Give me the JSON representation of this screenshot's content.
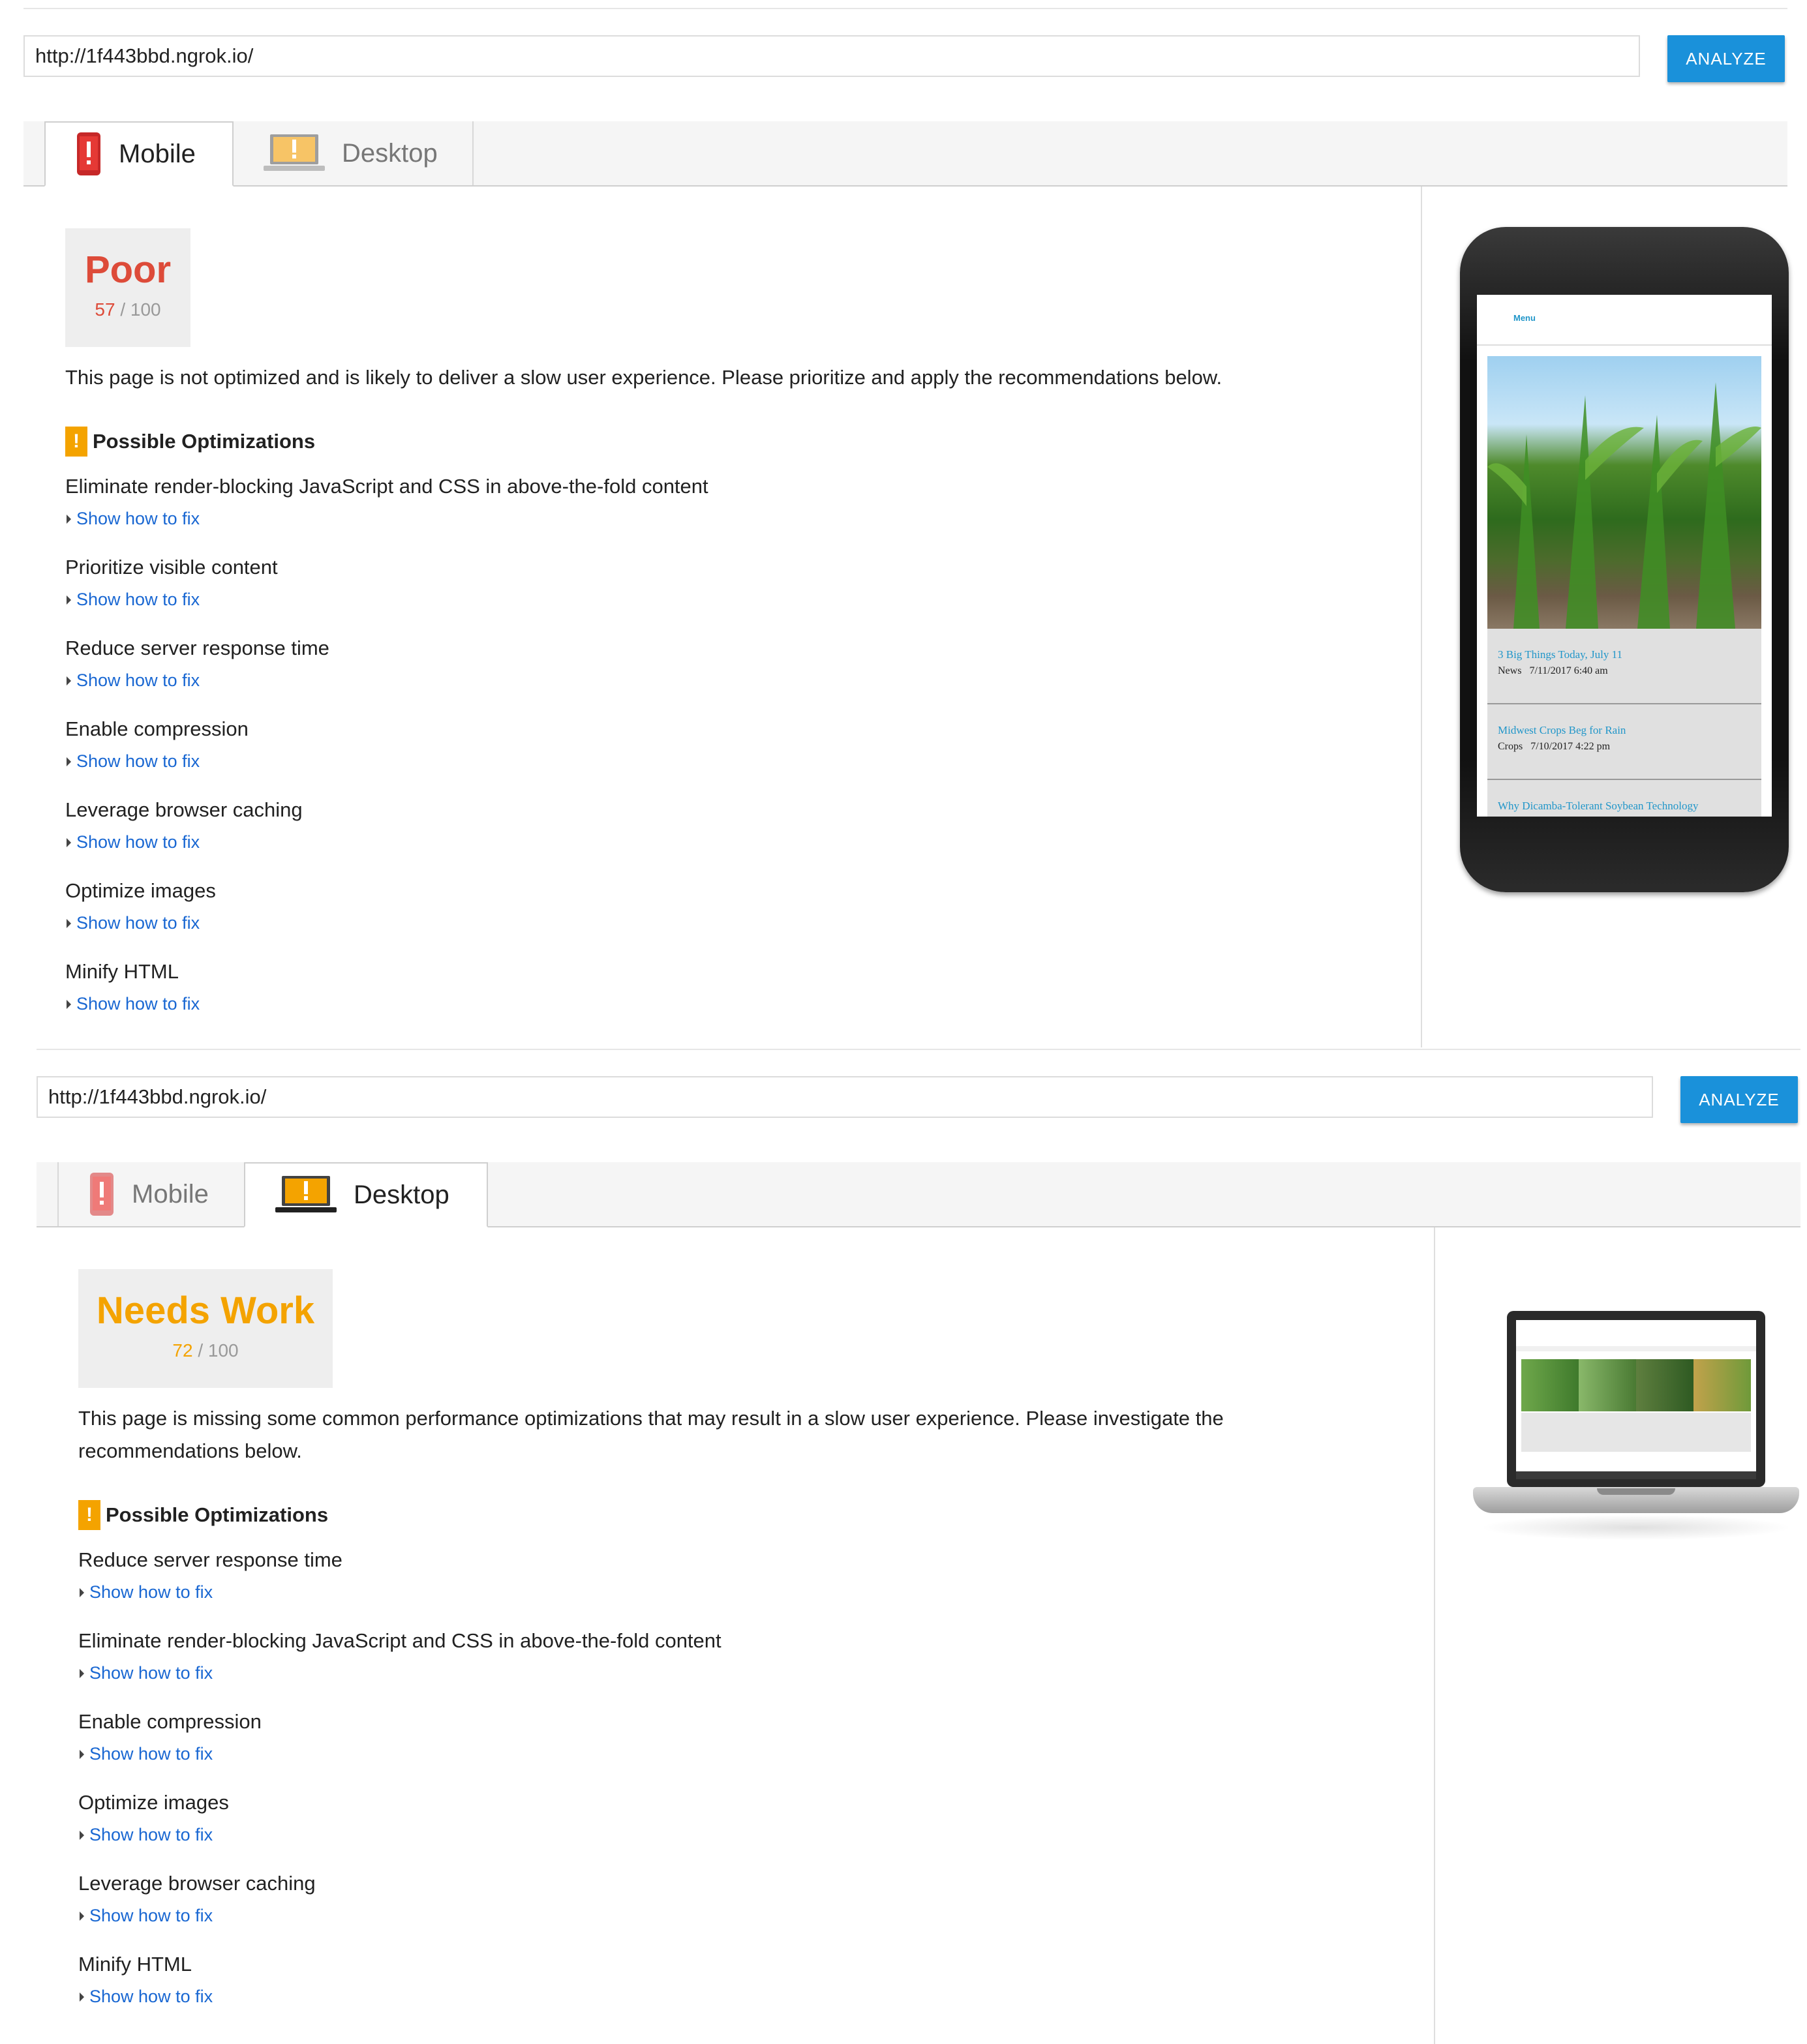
{
  "colors": {
    "accent": "#1a91da",
    "poor": "#dd4b39",
    "needs_work": "#f4a300",
    "link": "#1967d2"
  },
  "top": {
    "url_value": "http://1f443bbd.ngrok.io/",
    "analyze_label": "ANALYZE",
    "tabs": [
      {
        "label": "Mobile",
        "icon": "mobile-warning-icon",
        "active": true
      },
      {
        "label": "Desktop",
        "icon": "desktop-warning-icon",
        "active": false
      }
    ],
    "score": {
      "label": "Poor",
      "value": "57",
      "max": "/ 100"
    },
    "summary": "This page is not optimized and is likely to deliver a slow user experience. Please prioritize and apply the recommendations below.",
    "opt_heading": "Possible Optimizations",
    "rules": [
      "Eliminate render-blocking JavaScript and CSS in above-the-fold content",
      "Prioritize visible content",
      "Reduce server response time",
      "Enable compression",
      "Leverage browser caching",
      "Optimize images",
      "Minify HTML"
    ],
    "fix_label": "Show how to fix",
    "preview": {
      "menu": "Menu",
      "posts": [
        {
          "title": "3 Big Things Today, July 11",
          "category": "News",
          "date": "7/11/2017 6:40 am"
        },
        {
          "title": "Midwest Crops Beg for Rain",
          "category": "Crops",
          "date": "7/10/2017 4:22 pm"
        },
        {
          "title": "Why Dicamba-Tolerant Soybean Technology",
          "category": "",
          "date": ""
        }
      ]
    }
  },
  "bottom": {
    "url_value": "http://1f443bbd.ngrok.io/",
    "analyze_label": "ANALYZE",
    "tabs": [
      {
        "label": "Mobile",
        "icon": "mobile-warning-icon",
        "active": false
      },
      {
        "label": "Desktop",
        "icon": "desktop-warning-icon",
        "active": true
      }
    ],
    "score": {
      "label": "Needs Work",
      "value": "72",
      "max": "/ 100"
    },
    "summary_line1": "This page is missing some common performance optimizations that may result in a slow user experience. Please investigate the",
    "summary_line2": "recommendations below.",
    "opt_heading": "Possible Optimizations",
    "rules": [
      "Reduce server response time",
      "Eliminate render-blocking JavaScript and CSS in above-the-fold content",
      "Enable compression",
      "Optimize images",
      "Leverage browser caching",
      "Minify HTML"
    ],
    "fix_label": "Show how to fix"
  }
}
